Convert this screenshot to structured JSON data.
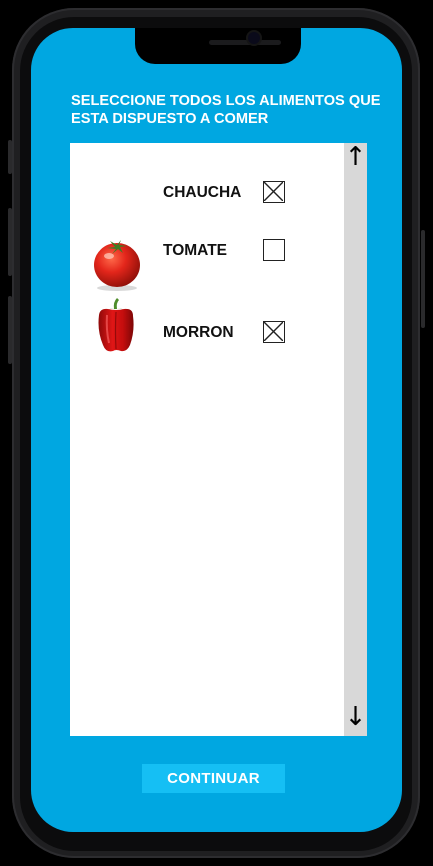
{
  "screen": {
    "title": "SELECCIONE TODOS LOS ALIMENTOS QUE ESTA DISPUESTO A COMER",
    "items": [
      {
        "label": "CHAUCHA",
        "checked": true,
        "image": "none"
      },
      {
        "label": "TOMATE",
        "checked": false,
        "image": "tomato-image"
      },
      {
        "label": "MORRON",
        "checked": true,
        "image": "pepper-image"
      }
    ],
    "continue_label": "CONTINUAR"
  },
  "colors": {
    "screen_bg": "#00a7e1",
    "button_bg": "#15bff4",
    "scrollbar_bg": "#d8d8d8"
  },
  "icons": {
    "scroll_up": "arrow-up-icon",
    "scroll_down": "arrow-down-icon"
  }
}
